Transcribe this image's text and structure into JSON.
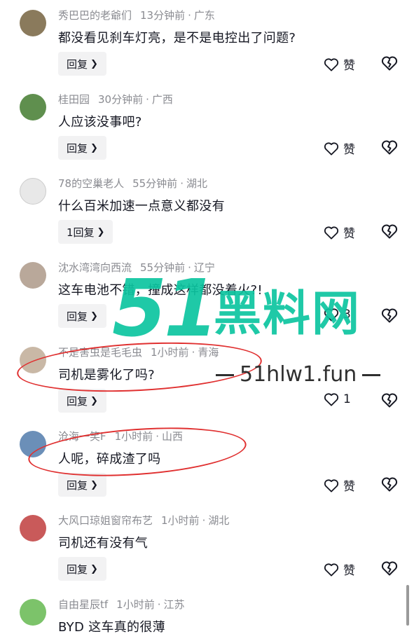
{
  "comments": [
    {
      "user": "秀巴巴的老爺们",
      "time": "13分钟前",
      "region": "广东",
      "text": "都没看见刹车灯亮，是不是电控出了问题?",
      "reply": "回复",
      "likes": "赞"
    },
    {
      "user": "桂田园",
      "time": "30分钟前",
      "region": "广西",
      "text": "人应该没事吧?",
      "reply": "回复",
      "likes": "赞"
    },
    {
      "user": "78的空巢老人",
      "time": "55分钟前",
      "region": "湖北",
      "text": "什么百米加速一点意义都没有",
      "reply": "1回复",
      "likes": "赞"
    },
    {
      "user": "沈水湾湾向西流",
      "time": "55分钟前",
      "region": "辽宁",
      "text": "这车电池不错，撞成这样都没着火?!",
      "reply": "回复",
      "likes": "3"
    },
    {
      "user": "不是害虫是毛毛虫",
      "time": "1小时前",
      "region": "青海",
      "text": "司机是雾化了吗?",
      "reply": "回复",
      "likes": "1"
    },
    {
      "user": "沧海一笑F",
      "time": "1小时前",
      "region": "山西",
      "text": "人呢，碎成渣了吗",
      "reply": "回复",
      "likes": "赞"
    },
    {
      "user": "大风口琼姐窗帘布艺",
      "time": "1小时前",
      "region": "湖北",
      "text": "司机还有没有气",
      "reply": "回复",
      "likes": "赞"
    },
    {
      "user": "自由星辰tf",
      "time": "1小时前",
      "region": "江苏",
      "text": "BYD 这车真的很薄",
      "reply": "",
      "likes": ""
    }
  ],
  "avatar_colors": [
    "#8a7a5c",
    "#5f8f4e",
    "#e8e8e8",
    "#b9a89a",
    "#c9b8a6",
    "#6b8fb8",
    "#c95a5a",
    "#7cc36a"
  ],
  "watermark": {
    "number": "51",
    "brand": "黑料网",
    "url": "51hlw1.fun"
  },
  "icons": {
    "like": "heart-outline-icon",
    "dislike": "broken-heart-icon",
    "chevron": "chevron-right-icon"
  },
  "accent_colors": {
    "watermark": "#0cc4a0",
    "highlight_ring": "#e03030",
    "meta_text": "#8a8b91"
  }
}
